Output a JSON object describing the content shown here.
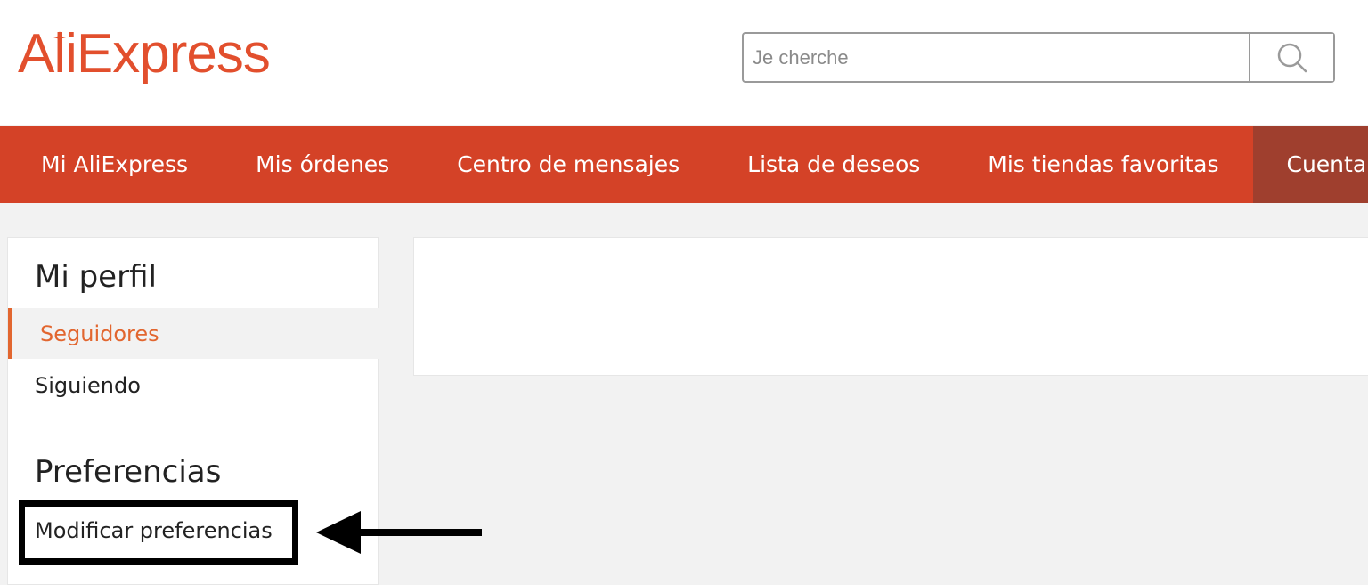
{
  "brand": {
    "name": "AliExpress",
    "color": "#e24f2d"
  },
  "search": {
    "placeholder": "Je cherche",
    "value": "",
    "icon": "search-icon"
  },
  "nav": {
    "items": [
      {
        "label": "Mi AliExpress",
        "active": false
      },
      {
        "label": "Mis órdenes",
        "active": false
      },
      {
        "label": "Centro de mensajes",
        "active": false
      },
      {
        "label": "Lista de deseos",
        "active": false
      },
      {
        "label": "Mis tiendas favoritas",
        "active": false
      },
      {
        "label": "Cuenta",
        "active": true
      }
    ],
    "color": "#d44227",
    "active_color": "#9f3f2e"
  },
  "sidebar": {
    "sections": [
      {
        "heading": "Mi perfil",
        "items": [
          {
            "label": "Seguidores",
            "active": true
          },
          {
            "label": "Siguiendo",
            "active": false
          }
        ]
      },
      {
        "heading": "Preferencias",
        "items": [
          {
            "label": "Modificar preferencias",
            "active": false,
            "highlighted": true
          }
        ]
      }
    ],
    "accent_color": "#e2662f"
  },
  "annotation": {
    "icon": "arrow-left-icon",
    "color": "#000000"
  }
}
